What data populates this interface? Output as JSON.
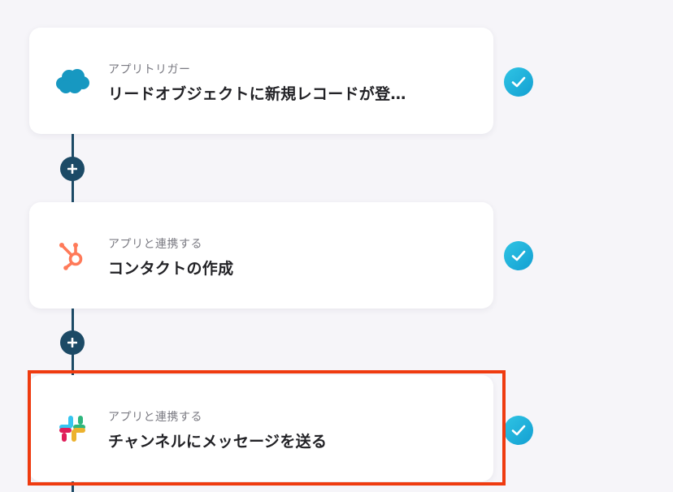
{
  "steps": [
    {
      "app": "salesforce",
      "icon": "salesforce-cloud-icon",
      "subtitle": "アプリトリガー",
      "title": "リードオブジェクトに新規レコードが登…",
      "status": "completed"
    },
    {
      "app": "hubspot",
      "icon": "hubspot-icon",
      "subtitle": "アプリと連携する",
      "title": "コンタクトの作成",
      "status": "completed"
    },
    {
      "app": "slack",
      "icon": "slack-icon",
      "subtitle": "アプリと連携する",
      "title": "チャンネルにメッセージを送る",
      "status": "completed",
      "highlighted": true
    }
  ],
  "colors": {
    "connector": "#1c4a66",
    "check": "#1eb2de",
    "highlight": "#ef3b10",
    "salesforce": "#1798c1",
    "hubspot": "#ff7a59"
  }
}
